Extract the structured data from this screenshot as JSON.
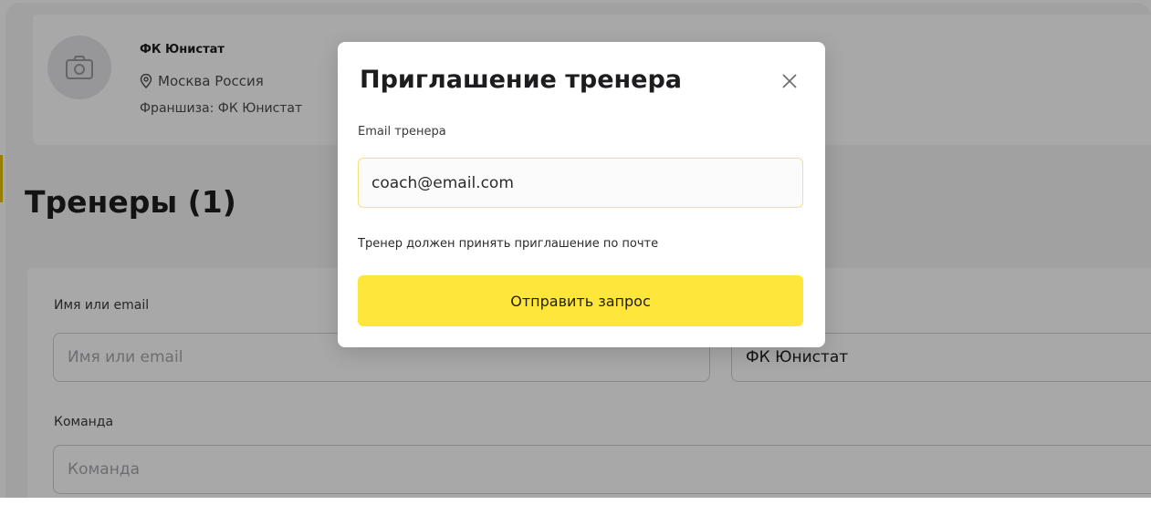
{
  "club": {
    "name": "ФК Юнистат",
    "location": "Москва Россия",
    "franchise": "Франшиза: ФК Юнистат"
  },
  "page": {
    "title": "Тренеры (1)"
  },
  "filters": {
    "name_label": "Имя или email",
    "name_placeholder": "Имя или email",
    "club_value": "ФК Юнистат",
    "team_label": "Команда",
    "team_placeholder": "Команда"
  },
  "modal": {
    "title": "Приглашение тренера",
    "email_label": "Email тренера",
    "email_value": "coach@email.com",
    "hint": "Тренер должен принять приглашение по почте",
    "submit_label": "Отправить запрос"
  },
  "colors": {
    "accent": "#ffe63b",
    "input_border_focus": "#f3e27c",
    "overlay": "rgba(0,0,0,0.34)"
  },
  "icons": {
    "avatar": "camera-icon",
    "location": "location-pin-icon",
    "close": "close-icon"
  }
}
